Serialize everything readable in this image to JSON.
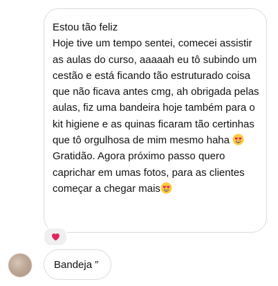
{
  "messages": [
    {
      "segments": [
        "Estou tão feliz\nHoje tive um tempo sentei, comecei assistir as aulas do curso, aaaaah eu tô subindo um cestão e está ficando tão estruturado coisa que não ficava antes cmg, ah obrigada pelas aulas, fiz uma bandeira hoje também para o kit higiene e as quinas ficaram tão certinhas que tô orgulhosa de mim mesmo haha ",
        " Gratidão. Agora próximo passo quero caprichar em umas fotos, para as clientes começar a chegar mais"
      ],
      "emoji": "heart-eyes-emoji",
      "reaction": "❤️"
    },
    {
      "text": "Bandeja ”"
    }
  ],
  "colors": {
    "bubble_border": "#dbdbdb",
    "reaction_bg": "#efefef",
    "heart": "#e0245e",
    "emoji_face": "#fccb3f"
  }
}
